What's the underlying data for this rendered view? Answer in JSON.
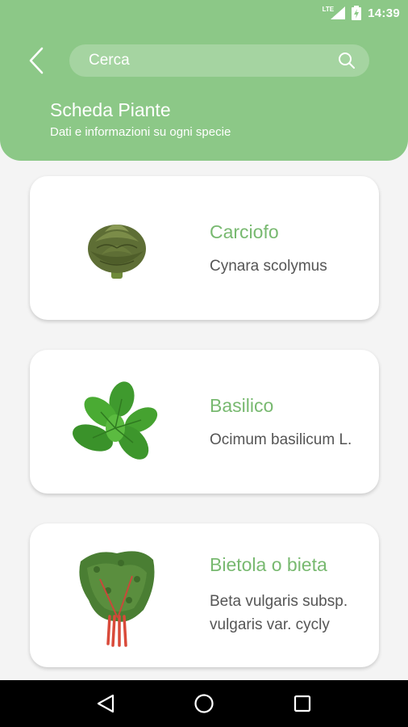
{
  "status_bar": {
    "time": "14:39",
    "network": "LTE",
    "icons": [
      "lte-signal-icon",
      "battery-charging-icon"
    ]
  },
  "header": {
    "back_icon": "chevron-left-icon",
    "search": {
      "placeholder": "Cerca",
      "value": "",
      "icon": "search-icon"
    },
    "title": "Scheda Piante",
    "subtitle": "Dati e informazioni su ogni specie"
  },
  "plants": [
    {
      "name": "Carciofo",
      "scientific_name": "Cynara scolymus",
      "image": "artichoke-image"
    },
    {
      "name": "Basilico",
      "scientific_name": "Ocimum basilicum L.",
      "image": "basil-image"
    },
    {
      "name": "Bietola o bieta",
      "scientific_name": "Beta vulgaris subsp. vulgaris var. cycly",
      "image": "chard-image"
    }
  ],
  "nav_bar": {
    "buttons": [
      "back-triangle-icon",
      "home-circle-icon",
      "recents-square-icon"
    ]
  },
  "colors": {
    "header_green": "#8cc887",
    "plant_name_green": "#78b970",
    "background": "#f4f4f4",
    "card": "#ffffff"
  }
}
